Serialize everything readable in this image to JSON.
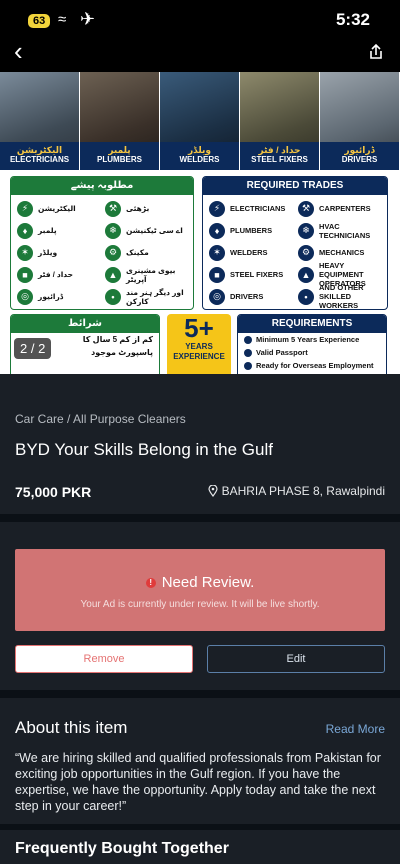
{
  "status_bar": {
    "battery": "63",
    "time": "5:32"
  },
  "ad_image": {
    "photos": [
      {
        "urdu": "الیکٹریشن",
        "en": "ELECTRICIANS"
      },
      {
        "urdu": "پلمبر",
        "en": "PLUMBERS"
      },
      {
        "urdu": "ویلڈر",
        "en": "WELDERS"
      },
      {
        "urdu": "حداد / فٹر",
        "en": "STEEL FIXERS"
      },
      {
        "urdu": "ڈرائیور",
        "en": "DRIVERS"
      }
    ],
    "urdu_panel_title": "مطلوبہ پیشے",
    "urdu_trades": [
      "الیکٹریشن",
      "بڑھئی",
      "پلمبر",
      "اے سی ٹیکنیشن",
      "ویلڈر",
      "مکینک",
      "حداد / فٹر",
      "بیوی مشینری آپریٹر",
      "ڈرائیور",
      "اور دیگر ہنر مند کارکن"
    ],
    "en_panel_title": "REQUIRED TRADES",
    "en_trades": [
      "ELECTRICIANS",
      "CARPENTERS",
      "PLUMBERS",
      "HVAC TECHNICIANS",
      "WELDERS",
      "MECHANICS",
      "STEEL FIXERS",
      "HEAVY EQUIPMENT OPERATORS",
      "DRIVERS",
      "AND OTHER SKILLED WORKERS"
    ],
    "conditions_title": "شرائط",
    "conditions": [
      "کم از کم 5 سال کا",
      "پاسپورٹ موجود"
    ],
    "badge_big": "5+",
    "badge_small1": "YEARS",
    "badge_small2": "EXPERIENCE",
    "requirements_title": "REQUIREMENTS",
    "requirements": [
      "Minimum 5 Years Experience",
      "Valid Passport",
      "Ready for Overseas Employment"
    ],
    "counter": "2 / 2"
  },
  "listing": {
    "category": "Car Care / All Purpose Cleaners",
    "title": "BYD Your Skills Belong in the Gulf",
    "price": "75,000 PKR",
    "location": "BAHRIA PHASE 8, Rawalpindi"
  },
  "review": {
    "title": "Need Review.",
    "subtitle": "Your Ad is currently under review. It will be live shortly."
  },
  "buttons": {
    "remove": "Remove",
    "edit": "Edit"
  },
  "about": {
    "title": "About this item",
    "read_more": "Read More",
    "text": "“We are hiring skilled and qualified professionals from Pakistan for exciting job opportunities in the Gulf region. If you have the expertise, we have the opportunity. Apply today and take the next step in your career!”"
  },
  "fbt": {
    "title": "Frequently Bought Together"
  },
  "colors": {
    "review_bg": "#d17474",
    "accent_blue": "#7aa7d6",
    "remove_red": "#e57373"
  }
}
